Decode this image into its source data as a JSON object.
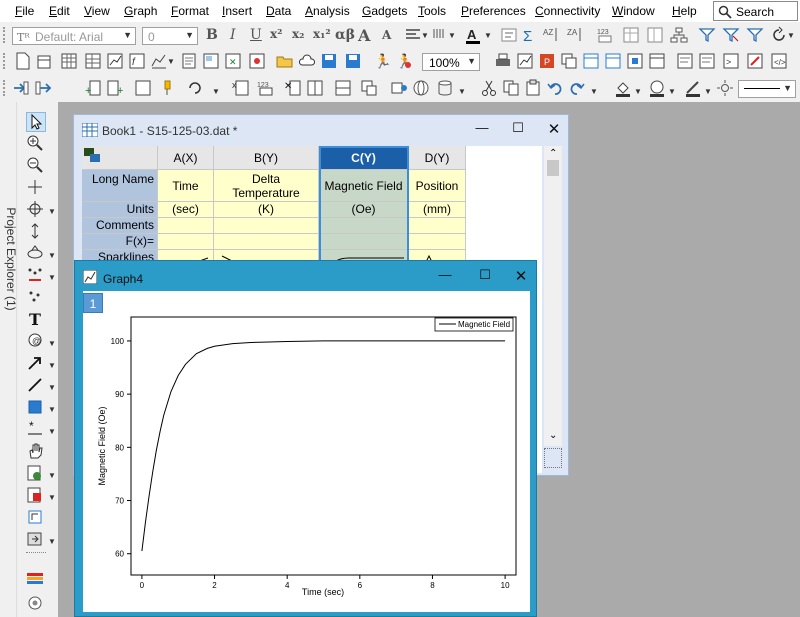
{
  "menu": [
    "File",
    "Edit",
    "View",
    "Graph",
    "Format",
    "Insert",
    "Data",
    "Analysis",
    "Gadgets",
    "Tools",
    "Preferences",
    "Connectivity",
    "Window",
    "Help"
  ],
  "search": {
    "label": "Search"
  },
  "format_toolbar": {
    "font": "Default: Arial",
    "size": "0",
    "bold": "B",
    "italic": "I",
    "underline": "U",
    "superscript": "x²",
    "subscript": "x₂",
    "supsub": "x₁²",
    "greek": "αβ",
    "font_up": "A",
    "font_down": "A"
  },
  "standard_toolbar": {
    "zoom": "100%"
  },
  "project_explorer": {
    "label": "Project Explorer (1)"
  },
  "workbook": {
    "title": "Book1 - S15-125-03.dat *",
    "columns": [
      "A(X)",
      "B(Y)",
      "C(Y)",
      "D(Y)"
    ],
    "row_labels": [
      "Long Name",
      "Units",
      "Comments",
      "F(x)=",
      "Sparklines"
    ],
    "long_names": [
      "Time",
      "Delta Temperature",
      "Magnetic Field",
      "Position"
    ],
    "units": [
      "(sec)",
      "(K)",
      "(Oe)",
      "(mm)"
    ],
    "selected_column": "C(Y)"
  },
  "graph": {
    "title": "Graph4",
    "layer": "1",
    "chart_data": {
      "type": "line",
      "xlabel": "Time (sec)",
      "ylabel": "Magnetic Field (Oe)",
      "xlim": [
        -0.3,
        10.3
      ],
      "ylim": [
        56,
        104.5
      ],
      "xticks": [
        "0",
        "2",
        "4",
        "6",
        "8",
        "10"
      ],
      "yticks": [
        "60",
        "70",
        "80",
        "90",
        "100"
      ],
      "legend": "top-right",
      "series": [
        {
          "name": "Magnetic Field",
          "x": [
            0,
            0.1,
            0.2,
            0.3,
            0.4,
            0.5,
            0.6,
            0.8,
            1.0,
            1.2,
            1.5,
            1.8,
            2.0,
            2.5,
            3.0,
            3.5,
            4.0,
            5.0,
            6.0,
            7.0,
            8.0,
            9.0,
            10.0
          ],
          "y": [
            60.5,
            66.0,
            71.0,
            75.5,
            79.5,
            83.0,
            86.0,
            90.5,
            93.5,
            95.6,
            97.6,
            98.6,
            99.0,
            99.5,
            99.7,
            99.8,
            99.9,
            100,
            100,
            100,
            100,
            100,
            100
          ]
        }
      ]
    }
  },
  "colors": {
    "workbook_bg": "#dce6f4",
    "graph_frame": "#2b9bc8",
    "selected_header": "#1a5fa8",
    "label_col": "#b0c4de",
    "yellow_row": "#ffffcc"
  }
}
